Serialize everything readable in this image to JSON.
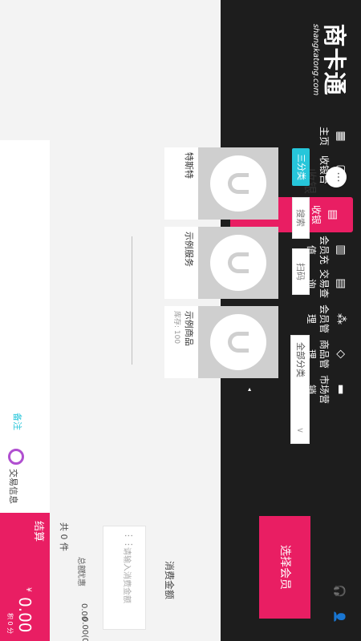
{
  "brand": {
    "name": "商卡通",
    "site": "shangkatong.com"
  },
  "nav": {
    "items": [
      {
        "label": "主页",
        "icon": "grid-icon"
      },
      {
        "label": "收银台",
        "icon": "pos-terminal-icon"
      },
      {
        "label": "收银",
        "icon": "cashier-icon"
      },
      {
        "label": "会员充值",
        "icon": "member-card-icon"
      },
      {
        "label": "交易查询",
        "icon": "receipt-icon"
      },
      {
        "label": "会员管理",
        "icon": "members-icon"
      },
      {
        "label": "商品管理",
        "icon": "tag-icon"
      },
      {
        "label": "市场营销",
        "icon": "bookmark-icon"
      }
    ],
    "caret": "◂",
    "active_index": 2
  },
  "page": {
    "title": "收银",
    "more": "···"
  },
  "filters": {
    "category": "三分类",
    "search": "搜索",
    "scan": "扫码",
    "all_category": "全部分类",
    "chevron": "∨"
  },
  "products": [
    {
      "name": "特斯特",
      "stock": ""
    },
    {
      "name": "示例服务",
      "stock": ""
    },
    {
      "name": "示例商品",
      "stock": "库存: 100"
    }
  ],
  "member": {
    "button": "选择会员"
  },
  "spend": {
    "label": "消费金额",
    "placeholder": "请输入消费金额"
  },
  "summary": {
    "items": "共 0 件",
    "total_label": "总额",
    "total": "0.00",
    "discount_label": "优惠",
    "discount": "0.00(0 折)"
  },
  "footer": {
    "remark": "备注",
    "trans_info": "交易信息",
    "settle": "结算",
    "currency": "¥",
    "amount": "0.00",
    "sub": "积 0 分"
  },
  "colors": {
    "accent": "#e91e63",
    "teal": "#26c6da",
    "header": "#1d1d1d"
  }
}
